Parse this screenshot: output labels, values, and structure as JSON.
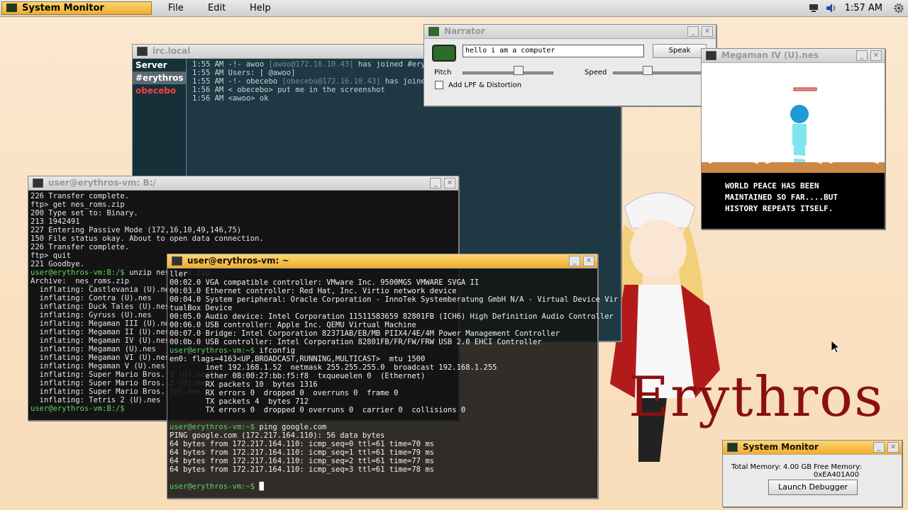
{
  "panel": {
    "app_button": "System Monitor",
    "menus": [
      "File",
      "Edit",
      "Help"
    ],
    "clock": "1:57 AM",
    "tray_icons": [
      "network-icon",
      "volume-icon",
      "gear-icon"
    ]
  },
  "irc": {
    "title": "irc.local",
    "channels": [
      "Server",
      "#erythros",
      "obecebo"
    ],
    "log": [
      {
        "t": "1:55 AM",
        "sep": "-!-",
        "nick": "awoo",
        "host": "[awoo@172.16.10.43]",
        "msg": "has joined #erythros"
      },
      {
        "t": "1:55 AM",
        "sep": "",
        "nick": "",
        "host": "",
        "msg": "Users: [ @awoo]"
      },
      {
        "t": "1:55 AM",
        "sep": "-!-",
        "nick": "obecebo",
        "host": "[obecebo@172.16.10.43]",
        "msg": "has joined #erythros"
      },
      {
        "t": "1:56 AM",
        "sep": "<",
        "nick": "obecebo>",
        "host": "",
        "msg": "put me in the screenshot"
      },
      {
        "t": "1:56 AM",
        "sep": "<awoo>",
        "nick": "",
        "host": "",
        "msg": "ok"
      }
    ]
  },
  "narrator": {
    "title": "Narrator",
    "input_value": "hello i am a computer",
    "speak_label": "Speak",
    "pitch_label": "Pitch",
    "speed_label": "Speed",
    "pitch_value": 0.62,
    "speed_value": 0.38,
    "lpf_label": "Add LPF & Distortion",
    "lpf_checked": false
  },
  "megaman": {
    "title": "Megaman IV (U).nes",
    "story": "WORLD PEACE HAS BEEN\nMAINTAINED SO FAR....BUT\nHISTORY REPEATS ITSELF."
  },
  "ftp_term": {
    "title": "user@erythros-vm: B:/",
    "lines": [
      "226 Transfer complete.",
      "ftp> get nes_roms.zip",
      "200 Type set to: Binary.",
      "213 1942491",
      "227 Entering Passive Mode (172,16,10,49,146,75)",
      "150 File status okay. About to open data connection.",
      "226 Transfer complete.",
      "ftp> quit",
      "221 Goodbye."
    ],
    "prompt1": "user@erythros-vm:B:/$",
    "cmd1": " unzip nes_roms.zip",
    "unzip": [
      "Archive:  nes_roms.zip",
      "  inflating: Castlevania (U).nes",
      "  inflating: Contra (U).nes",
      "  inflating: Duck Tales (U).nes",
      "  inflating: Gyruss (U).nes",
      "  inflating: Megaman III (U).nes",
      "  inflating: Megaman II (U).nes",
      "  inflating: Megaman IV (U).nes",
      "  inflating: Megaman (U).nes",
      "  inflating: Megaman VI (U).nes",
      "  inflating: Megaman V (U).nes",
      "  inflating: Super Mario Bros. 2 (U).nes",
      "  inflating: Super Mario Bros. 3 (U).nes",
      "  inflating: Super Mario Bros. (U).nes",
      "  inflating: Tetris 2 (U).nes"
    ],
    "prompt2": "user@erythros-vm:B:/$"
  },
  "main_term": {
    "title": "user@erythros-vm: ~",
    "lspci": [
      "ller",
      "00:02.0 VGA compatible controller: VMware Inc. 9500MGS VMWARE SVGA II",
      "00:03.0 Ethernet controller: Red Hat, Inc. Virtio network device",
      "00:04.0 System peripheral: Oracle Corporation - InnoTek Systemberatung GmbH N/A - Virtual Device Vir",
      "tualBox Device",
      "00:05.0 Audio device: Intel Corporation 11511583659 82801FB (ICH6) High Definition Audio Controller",
      "00:06.0 USB controller: Apple Inc. QEMU Virtual Machine",
      "00:07.0 Bridge: Intel Corporation 82371AB/EB/MB PIIX4/4E/4M Power Management Controller",
      "00:0b.0 USB controller: Intel Corporation 82801FB/FR/FW/FRW USB 2.0 EHCI Controller"
    ],
    "prompt": "user@erythros-vm:~$",
    "cmd_ifconfig": " ifconfig",
    "ifconfig": [
      "en0: flags=4163<UP,BROADCAST,RUNNING,MULTICAST>  mtu 1500",
      "        inet 192.168.1.52  netmask 255.255.255.0  broadcast 192.168.1.255",
      "        ether 08:00:27:bb:f5:f8  txqueuelen 0  (Ethernet)",
      "        RX packets 10  bytes 1316",
      "        RX errors 0  dropped 0  overruns 0  frame 0",
      "        TX packets 4  bytes 712",
      "        TX errors 0  dropped 0 overruns 0  carrier 0  collisions 0"
    ],
    "cmd_ping": " ping google.com",
    "ping": [
      "PING google.com (172.217.164.110): 56 data bytes",
      "64 bytes from 172.217.164.110: icmp_seq=0 ttl=61 time=70 ms",
      "64 bytes from 172.217.164.110: icmp_seq=1 ttl=61 time=79 ms",
      "64 bytes from 172.217.164.110: icmp_seq=2 ttl=61 time=77 ms",
      "64 bytes from 172.217.164.110: icmp_seq=3 ttl=61 time=78 ms"
    ]
  },
  "sysmon": {
    "title": "System Monitor",
    "total_memory": "Total Memory: 4.00 GB",
    "free_memory": "Free Memory: 0xEA401A00",
    "debug_label": "Launch Debugger"
  },
  "wallpaper": {
    "brand": "Erythros"
  },
  "colors": {
    "accent": "#f1ac2a",
    "prompt": "#5fd35f",
    "irc_bg": "#1e3844",
    "brand": "#8a1010"
  }
}
